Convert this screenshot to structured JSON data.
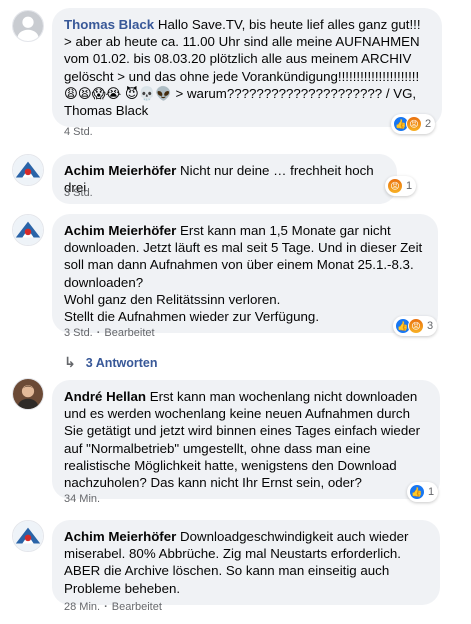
{
  "comments": [
    {
      "author": "Thomas Black",
      "text": "Hallo Save.TV, bis heute lief alles ganz gut!!! > aber ab heute ca. 11.00 Uhr sind alle meine AUFNAHMEN vom 01.02. bis 08.03.20 plötzlich alle aus meinem ARCHIV gelöscht > und das ohne jede Vorankündigung!!!!!!!!!!!!!!!!!!!!!! 😩😫😱😭 😈💀👽 > warum????????????????????? / VG, Thomas Black",
      "time": "4 Std.",
      "reaction_count": "2"
    },
    {
      "author": "Achim Meierhöfer",
      "text": "Nicht nur deine … frechheit hoch drei",
      "time": "3 Std.",
      "reaction_count": "1"
    },
    {
      "author": "Achim Meierhöfer",
      "text": "Erst kann man 1,5 Monate gar nicht downloaden. Jetzt läuft es mal seit 5 Tage. Und in dieser Zeit soll man dann Aufnahmen von über einem Monat 25.1.-8.3. downloaden?\nWohl ganz den Relitätssinn verloren.\nStellt die Aufnahmen wieder zur Verfügung.",
      "time": "3 Std.",
      "edited": "Bearbeitet",
      "reaction_count": "3"
    },
    {
      "author": "André Hellan",
      "text": "Erst kann man wochenlang nicht downloaden und es werden wochenlang keine neuen Aufnahmen durch Sie getätigt und jetzt wird binnen eines Tages einfach wieder auf \"Normalbetrieb\" umgestellt, ohne dass man eine realistische Möglichkeit hatte, wenigstens den Download nachzuholen? Das kann nicht Ihr Ernst sein, oder?",
      "time": "34 Min.",
      "reaction_count": "1"
    },
    {
      "author": "Achim Meierhöfer",
      "text": "Downloadgeschwindigkeit auch wieder miserabel. 80% Abbrüche. Zig mal Neustarts erforderlich. ABER die Archive löschen. So kann man einseitig auch Probleme beheben.",
      "time": "28 Min.",
      "edited": "Bearbeitet"
    }
  ],
  "replies_label": "3 Antworten",
  "icons": {
    "like": "like-icon",
    "angry": "angry-icon",
    "reply_arrow": "reply-arrow-icon"
  },
  "colors": {
    "bubble": "#f0f2f5",
    "link": "#385898",
    "like": "#1877f2",
    "angry": "#e9710f"
  }
}
